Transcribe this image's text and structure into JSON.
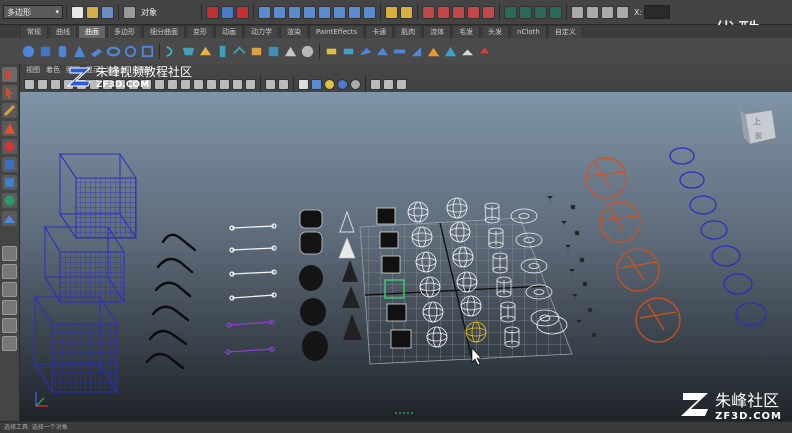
{
  "status_line": {
    "mode_menu": "多边形",
    "object_label": "对象",
    "coordinate_label": "X:"
  },
  "shelf_tabs": [
    {
      "label": "常规"
    },
    {
      "label": "曲线"
    },
    {
      "label": "曲面",
      "active": true
    },
    {
      "label": "多边形"
    },
    {
      "label": "细分曲面"
    },
    {
      "label": "变形"
    },
    {
      "label": "动画"
    },
    {
      "label": "动力学"
    },
    {
      "label": "渲染"
    },
    {
      "label": "PaintEffects"
    },
    {
      "label": "卡通"
    },
    {
      "label": "肌肉"
    },
    {
      "label": "流体"
    },
    {
      "label": "毛发"
    },
    {
      "label": "头发"
    },
    {
      "label": "nCloth"
    },
    {
      "label": "自定义"
    }
  ],
  "panel_menu": [
    "视图",
    "着色",
    "照明",
    "显示",
    "渲染器",
    "面板"
  ],
  "view_cube": {
    "top_label": "上",
    "front_label": "前"
  },
  "watermarks": {
    "top_right": "优酷",
    "mid_title": "朱峰视频教程社区",
    "mid_url": "ZF3D.COM",
    "bottom_title": "朱峰社区",
    "bottom_url": "ZF3D.COM"
  },
  "help_line": "选择工具: 选择一个对象",
  "colors": {
    "wire_blue": "#2b2fc0",
    "wire_white": "#f2f2f2",
    "wire_orange": "#d4501c",
    "selected_yellow": "#e8c020",
    "active_green": "#3ad070",
    "grid": "#9ca4ad"
  }
}
